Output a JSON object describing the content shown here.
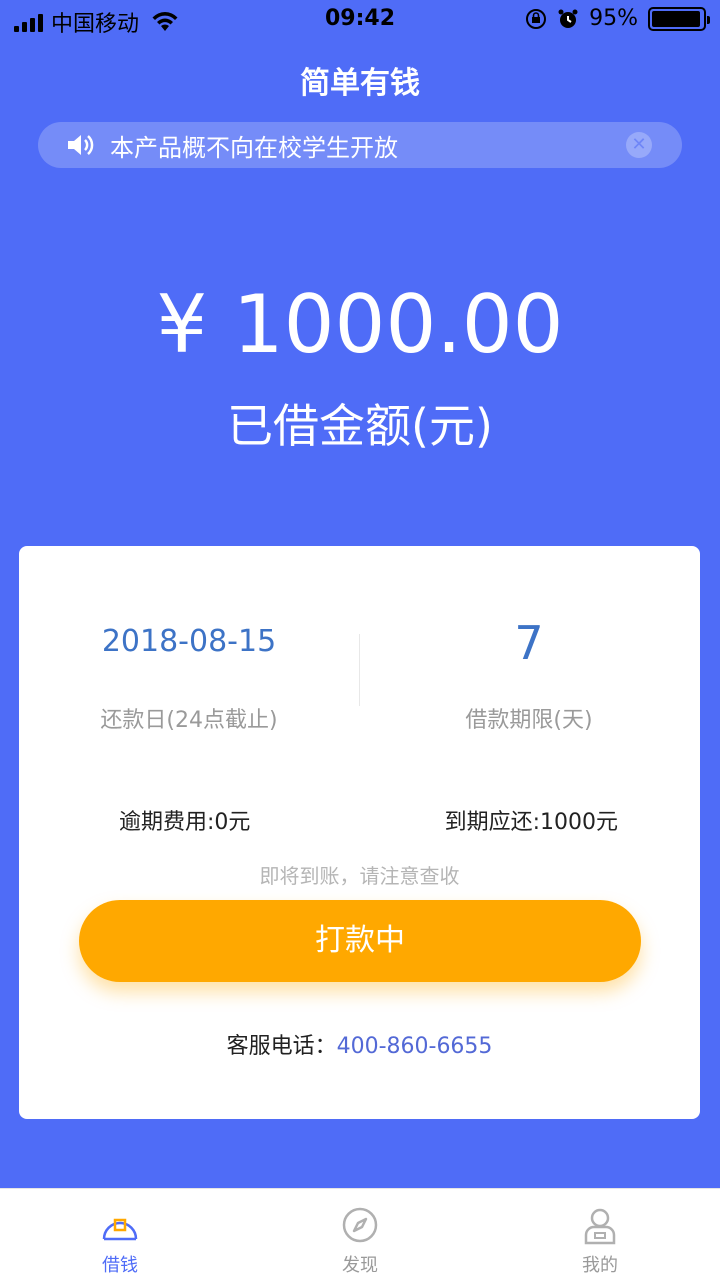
{
  "status_bar": {
    "carrier": "中国移动",
    "time": "09:42",
    "battery": "95%",
    "battery_level": 0.95
  },
  "header": {
    "title": "简单有钱"
  },
  "notice": {
    "text": "本产品概不向在校学生开放"
  },
  "summary": {
    "amount": "¥ 1000.00",
    "label": "已借金额(元)"
  },
  "card": {
    "due_date": {
      "value": "2018-08-15",
      "label": "还款日(24点截止)"
    },
    "term": {
      "value": "7",
      "label": "借款期限(天)"
    },
    "overdue_fee": "逾期费用:0元",
    "due_amount": "到期应还:1000元",
    "hint": "即将到账，请注意查收",
    "status_button": "打款中",
    "service_label": "客服电话：",
    "service_phone": "400-860-6655"
  },
  "tabbar": {
    "items": [
      {
        "label": "借钱",
        "icon": "borrow-icon",
        "active": true
      },
      {
        "label": "发现",
        "icon": "compass-icon",
        "active": false
      },
      {
        "label": "我的",
        "icon": "user-icon",
        "active": false
      }
    ]
  },
  "colors": {
    "primary": "#4f6cf7",
    "accent": "#ffa800",
    "value_blue": "#3d73c6"
  }
}
